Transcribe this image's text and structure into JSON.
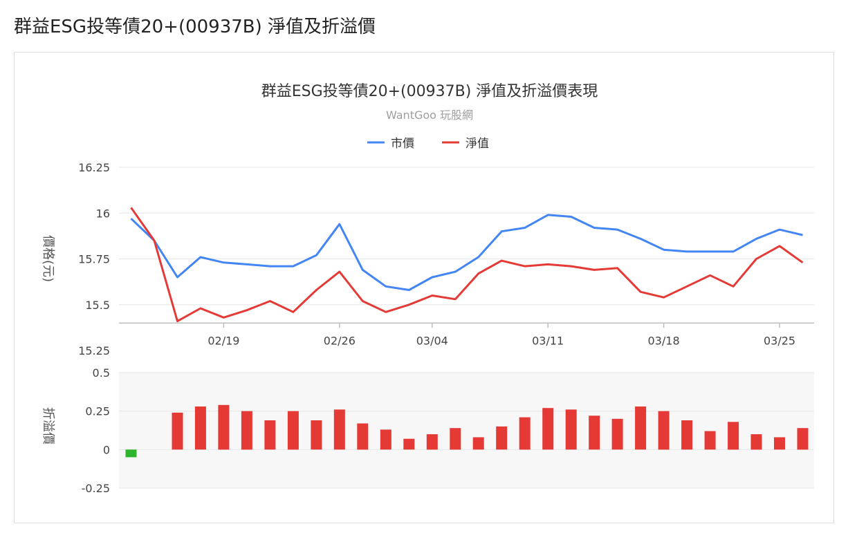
{
  "page_title": "群益ESG投等債20+(00937B) 淨值及折溢價",
  "colors": {
    "market_price": "#4285f4",
    "nav": "#e53935",
    "premium_positive": "#e53935",
    "premium_negative": "#2db52d",
    "discount_panel_bg": "#f7f7f7"
  },
  "chart_data": [
    {
      "type": "line",
      "title": "群益ESG投等債20+(00937B) 淨值及折溢價表現",
      "subtitle": "WantGoo 玩股網",
      "ylabel": "價格(元)",
      "ylim": [
        15.25,
        16.25
      ],
      "yticks": [
        "16.25",
        "16",
        "15.75",
        "15.5",
        "15.25"
      ],
      "ytick_values": [
        16.25,
        16,
        15.75,
        15.5,
        15.25
      ],
      "xticks": [
        "02/19",
        "02/26",
        "03/04",
        "03/11",
        "03/18",
        "03/25"
      ],
      "xtick_index": [
        4,
        9,
        13,
        18,
        23,
        28
      ],
      "x": [
        "02/13",
        "02/14",
        "02/15",
        "02/16",
        "02/19",
        "02/20",
        "02/21",
        "02/22",
        "02/23",
        "02/26",
        "02/27",
        "02/29",
        "03/01",
        "03/04",
        "03/05",
        "03/06",
        "03/07",
        "03/08",
        "03/11",
        "03/12",
        "03/13",
        "03/14",
        "03/15",
        "03/18",
        "03/19",
        "03/20",
        "03/21",
        "03/22",
        "03/25",
        "03/26"
      ],
      "legend": "top-center",
      "series": [
        {
          "name": "市價",
          "color": "#4285f4",
          "values": [
            15.97,
            15.85,
            15.65,
            15.76,
            15.73,
            15.72,
            15.71,
            15.71,
            15.77,
            15.94,
            15.69,
            15.6,
            15.58,
            15.65,
            15.68,
            15.76,
            15.9,
            15.92,
            15.99,
            15.98,
            15.92,
            15.91,
            15.86,
            15.8,
            15.79,
            15.79,
            15.79,
            15.86,
            15.91,
            15.88
          ]
        },
        {
          "name": "淨值",
          "color": "#e53935",
          "values": [
            16.03,
            15.85,
            15.41,
            15.48,
            15.43,
            15.47,
            15.52,
            15.46,
            15.58,
            15.68,
            15.52,
            15.46,
            15.5,
            15.55,
            15.53,
            15.67,
            15.74,
            15.71,
            15.72,
            15.71,
            15.69,
            15.7,
            15.57,
            15.54,
            15.6,
            15.66,
            15.6,
            15.75,
            15.82,
            15.73
          ]
        }
      ]
    },
    {
      "type": "bar",
      "ylabel": "折溢價",
      "ylim": [
        -0.25,
        0.5
      ],
      "yticks": [
        "0.5",
        "0.25",
        "0",
        "-0.25"
      ],
      "ytick_values": [
        0.5,
        0.25,
        0,
        -0.25
      ],
      "series": [
        {
          "name": "折溢價",
          "values": [
            -0.05,
            0,
            0.24,
            0.28,
            0.29,
            0.25,
            0.19,
            0.25,
            0.19,
            0.26,
            0.17,
            0.13,
            0.07,
            0.1,
            0.14,
            0.08,
            0.15,
            0.21,
            0.27,
            0.26,
            0.22,
            0.2,
            0.28,
            0.25,
            0.19,
            0.12,
            0.18,
            0.1,
            0.08,
            0.14
          ]
        }
      ]
    }
  ]
}
